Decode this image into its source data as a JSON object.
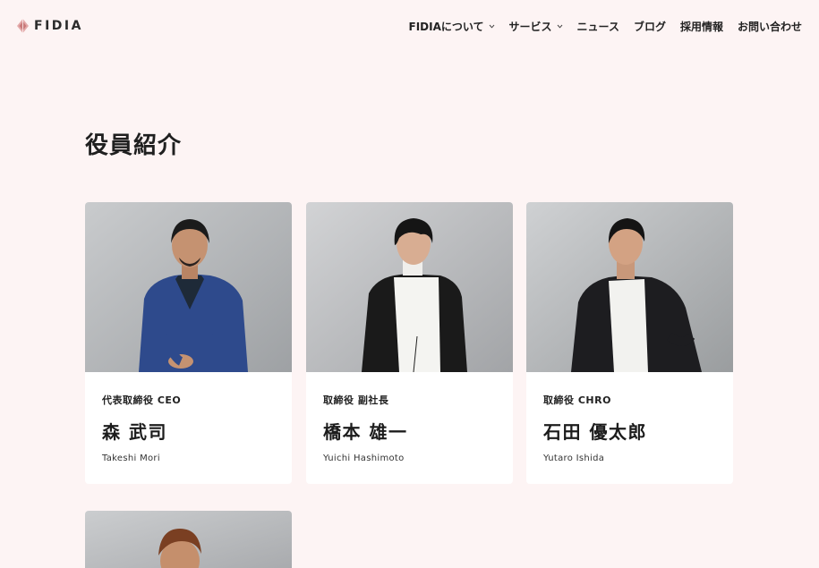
{
  "header": {
    "logo_text": "FIDIA",
    "nav": [
      {
        "label": "FIDIAについて",
        "dropdown": true
      },
      {
        "label": "サービス",
        "dropdown": true
      },
      {
        "label": "ニュース",
        "dropdown": false
      },
      {
        "label": "ブログ",
        "dropdown": false
      },
      {
        "label": "採用情報",
        "dropdown": false
      },
      {
        "label": "お問い合わせ",
        "dropdown": false
      }
    ]
  },
  "page_title": "役員紹介",
  "members": [
    {
      "role": "代表取締役 CEO",
      "name": "森 武司",
      "romaji": "Takeshi Mori"
    },
    {
      "role": "取締役 副社長",
      "name": "橋本 雄一",
      "romaji": "Yuichi Hashimoto"
    },
    {
      "role": "取締役 CHRO",
      "name": "石田 優太郎",
      "romaji": "Yutaro Ishida"
    }
  ],
  "colors": {
    "background": "#fdf4f4",
    "card": "#ffffff",
    "text": "#222222",
    "logo_accent": "#d48a8a"
  },
  "icons": [
    "fidia-logo-icon",
    "chevron-down-icon"
  ]
}
